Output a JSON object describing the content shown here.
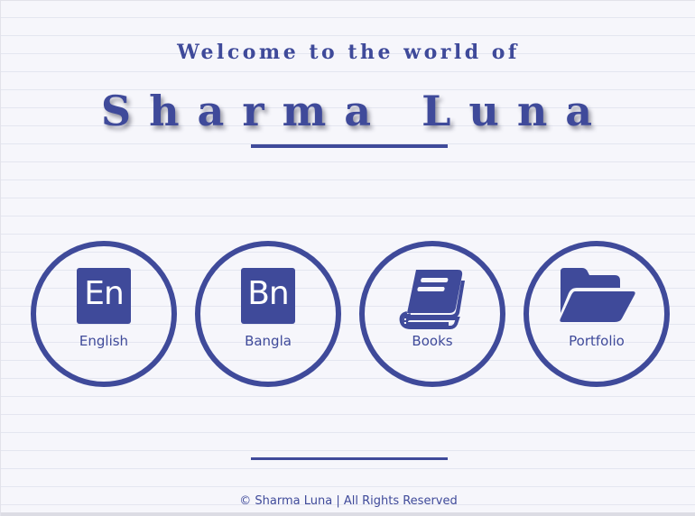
{
  "header": {
    "welcome_text": "Welcome to the world of",
    "brand_name": "Sharma Luna"
  },
  "nav": [
    {
      "label": "English",
      "icon": "english-en-icon",
      "badge": "En"
    },
    {
      "label": "Bangla",
      "icon": "bangla-bn-icon",
      "badge": "Bn"
    },
    {
      "label": "Books",
      "icon": "book-icon"
    },
    {
      "label": "Portfolio",
      "icon": "folder-open-icon"
    }
  ],
  "footer": {
    "copyright": "© Sharma Luna | All Rights Reserved"
  },
  "colors": {
    "accent": "#3f4a9a",
    "background": "#f6f6fb",
    "rule_lines": "#e4e6f0"
  }
}
